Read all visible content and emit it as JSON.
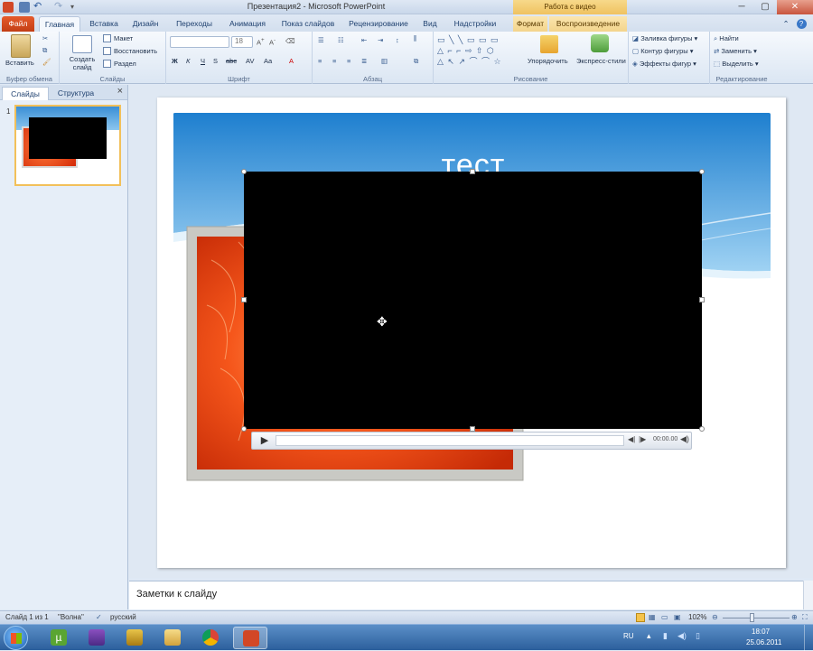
{
  "window": {
    "title": "Презентация2 - Microsoft PowerPoint",
    "context_header": "Работа с видео"
  },
  "tabs": [
    {
      "label": "Файл"
    },
    {
      "label": "Главная"
    },
    {
      "label": "Вставка"
    },
    {
      "label": "Дизайн"
    },
    {
      "label": "Переходы"
    },
    {
      "label": "Анимация"
    },
    {
      "label": "Показ слайдов"
    },
    {
      "label": "Рецензирование"
    },
    {
      "label": "Вид"
    },
    {
      "label": "Надстройки"
    },
    {
      "label": "Формат"
    },
    {
      "label": "Воспроизведение"
    }
  ],
  "ribbon": {
    "groups": {
      "clipboard": "Буфер обмена",
      "slides": "Слайды",
      "font": "Шрифт",
      "paragraph": "Абзац",
      "drawing": "Рисование",
      "editing": "Редактирование"
    },
    "paste": "Вставить",
    "new_slide": "Создать слайд",
    "layout": "Макет",
    "reset": "Восстановить",
    "section": "Раздел",
    "font_size": "18",
    "arrange": "Упорядочить",
    "quick_styles": "Экспресс-стили",
    "shape_fill": "Заливка фигуры",
    "shape_outline": "Контур фигуры",
    "shape_effects": "Эффекты фигур",
    "find": "Найти",
    "replace": "Заменить",
    "select": "Выделить"
  },
  "left_panel": {
    "tab_slides": "Слайды",
    "tab_outline": "Структура",
    "close": "×",
    "thumbnail_number": "1"
  },
  "slide": {
    "title": "тест"
  },
  "media_player": {
    "time": "00:00.00"
  },
  "notes": {
    "placeholder": "Заметки к слайду"
  },
  "status_bar": {
    "slide_info": "Слайд 1 из 1",
    "theme": "\"Волна\"",
    "language": "русский",
    "zoom": "102%"
  },
  "taskbar": {
    "language": "RU",
    "time": "18:07",
    "date": "25.06.2011"
  }
}
